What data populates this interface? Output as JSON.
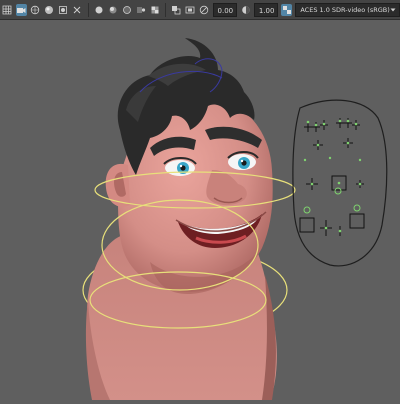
{
  "toolbar": {
    "icons": [
      "grid-icon",
      "camera-icon",
      "wireframe-icon",
      "smooth-shade-icon",
      "bounding-box-icon",
      "xray-icon",
      "lights-icon",
      "shadows-icon",
      "ambient-occlusion-icon",
      "motion-blur-icon",
      "anti-alias-icon",
      "isolate-select-icon",
      "gate-mask-icon",
      "exposure-icon"
    ],
    "exposure_value": "0.00",
    "gamma_value": "1.00",
    "color_space": "ACES 1.0 SDR-video (sRGB)"
  },
  "colors": {
    "viewport_bg": "#5f5f5f",
    "skin": "#d9928c",
    "hair": "#262626",
    "curve_yellow": "#e8e07a",
    "curve_blue": "#3a3aa0",
    "eye_iris": "#3aa6c8",
    "ui_green": "#7fd36f"
  }
}
